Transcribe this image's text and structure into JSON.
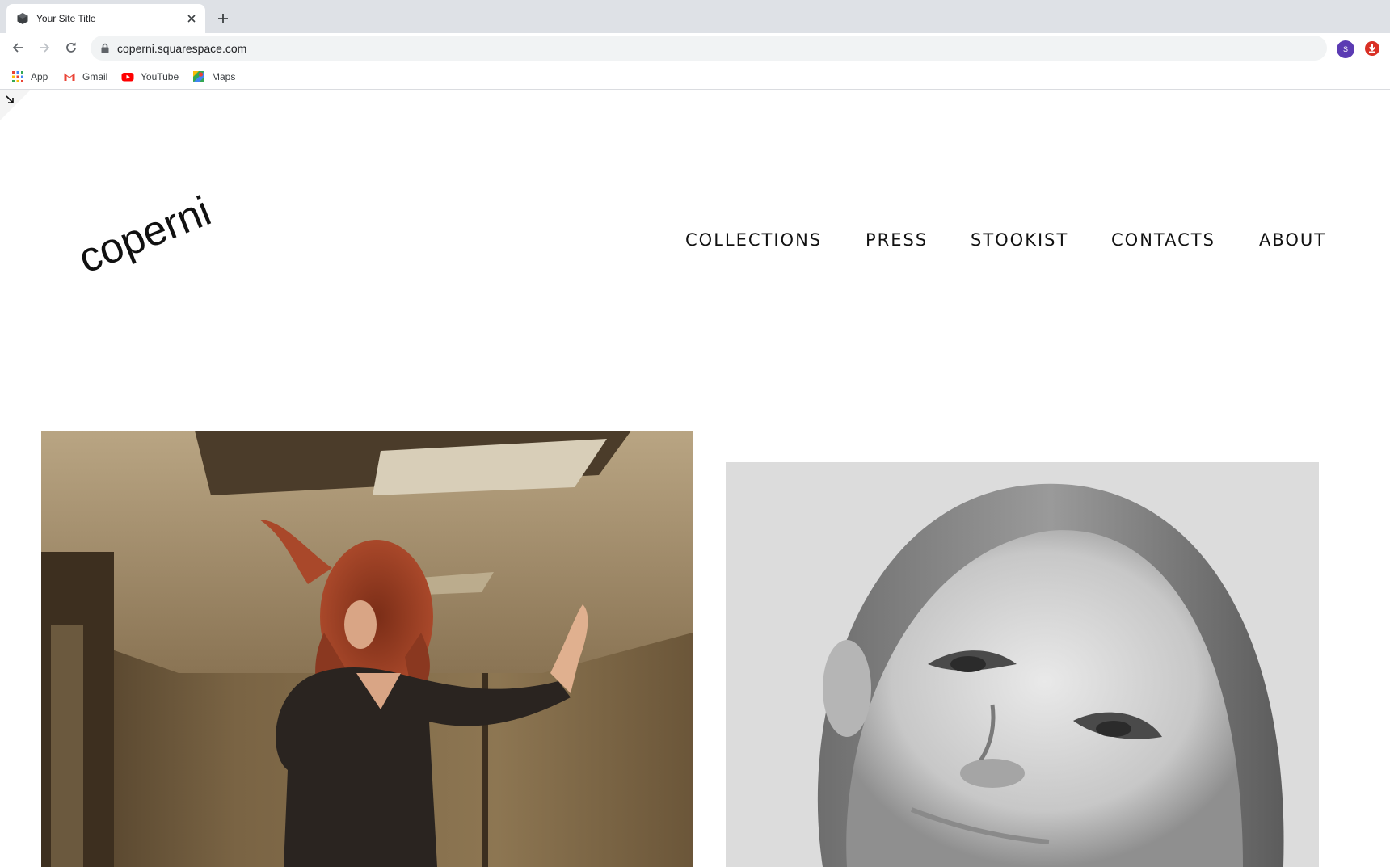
{
  "browser": {
    "tab": {
      "title": "Your Site Title",
      "close_label": "×"
    },
    "new_tab_label": "+",
    "url": "coperni.squarespace.com",
    "profile_initial": "S",
    "bookmarks": [
      {
        "label": "App",
        "icon": "apps-grid-icon"
      },
      {
        "label": "Gmail",
        "icon": "gmail-icon"
      },
      {
        "label": "YouTube",
        "icon": "youtube-icon"
      },
      {
        "label": "Maps",
        "icon": "maps-icon"
      }
    ]
  },
  "site": {
    "logo_text": "coperni",
    "nav": [
      "COLLECTIONS",
      "PRESS",
      "STOOKIST",
      "CONTACTS",
      "ABOUT"
    ]
  },
  "colors": {
    "tabstrip": "#dee1e6",
    "omnibox": "#f1f3f4",
    "profile": "#5b3bb3",
    "extension": "#d93025",
    "text": "#111111"
  }
}
